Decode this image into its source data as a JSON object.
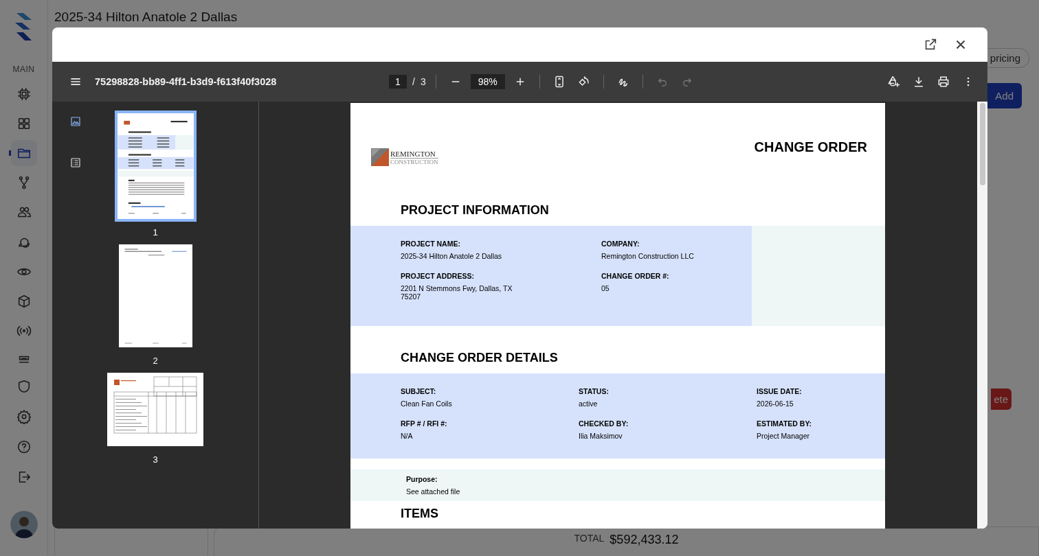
{
  "sidebar": {
    "section_label": "MAIN",
    "items": [
      {
        "selected": false
      },
      {
        "selected": false
      },
      {
        "selected": true
      },
      {
        "selected": false
      },
      {
        "selected": false
      },
      {
        "selected": false
      },
      {
        "selected": false
      },
      {
        "selected": false
      },
      {
        "selected": false
      },
      {
        "selected": false
      }
    ],
    "bottom_items": [
      {
        "selected": false
      },
      {
        "selected": false
      },
      {
        "selected": false
      },
      {
        "selected": false
      }
    ]
  },
  "page_title": "2025-34 Hilton Anatole 2 Dallas",
  "background": {
    "chip": "pricing",
    "add_button": "Add",
    "delete_button": "ete",
    "total_label": "TOTAL",
    "total_value": "$592,433.12"
  },
  "viewer": {
    "file_name": "75298828-bb89-4ff1-b3d9-f613f40f3028",
    "page": "1",
    "page_separator": "/",
    "page_count": "3",
    "zoom": "98%",
    "undo_disabled": true,
    "redo_disabled": true,
    "rail": [
      {
        "selected": true
      },
      {
        "selected": false
      }
    ],
    "thumbnails": [
      {
        "label": "1",
        "selected": true,
        "kind": "portrait"
      },
      {
        "label": "2",
        "selected": false,
        "kind": "blank"
      },
      {
        "label": "3",
        "selected": false,
        "kind": "landscape"
      }
    ],
    "document": {
      "logo": {
        "name": "REMINGTON",
        "sub": "CONSTRUCTION"
      },
      "title": "CHANGE ORDER",
      "sections": [
        {
          "kind": "grid2",
          "heading": "PROJECT INFORMATION",
          "fields": [
            {
              "label": "PROJECT NAME:",
              "value": "2025-34 Hilton Anatole 2 Dallas"
            },
            {
              "label": "COMPANY:",
              "value": "Remington Construction LLC"
            },
            {
              "label": "PROJECT ADDRESS:",
              "value": "2201 N Stemmons Fwy, Dallas, TX 75207"
            },
            {
              "label": "CHANGE ORDER #:",
              "value": "05"
            }
          ]
        },
        {
          "kind": "grid3",
          "heading": "CHANGE ORDER DETAILS",
          "fields": [
            {
              "label": "SUBJECT:",
              "value": "Clean Fan Coils"
            },
            {
              "label": "STATUS:",
              "value": "active"
            },
            {
              "label": "ISSUE DATE:",
              "value": "2026-06-15"
            },
            {
              "label": "RFP # / RFI #:",
              "value": "N/A"
            },
            {
              "label": "CHECKED BY:",
              "value": "Ilia Maksimov"
            },
            {
              "label": "ESTIMATED BY:",
              "value": "Project Manager"
            }
          ]
        },
        {
          "kind": "note",
          "label": "Purpose:",
          "value": "See attached file"
        },
        {
          "kind": "heading",
          "heading": "ITEMS"
        }
      ]
    }
  }
}
